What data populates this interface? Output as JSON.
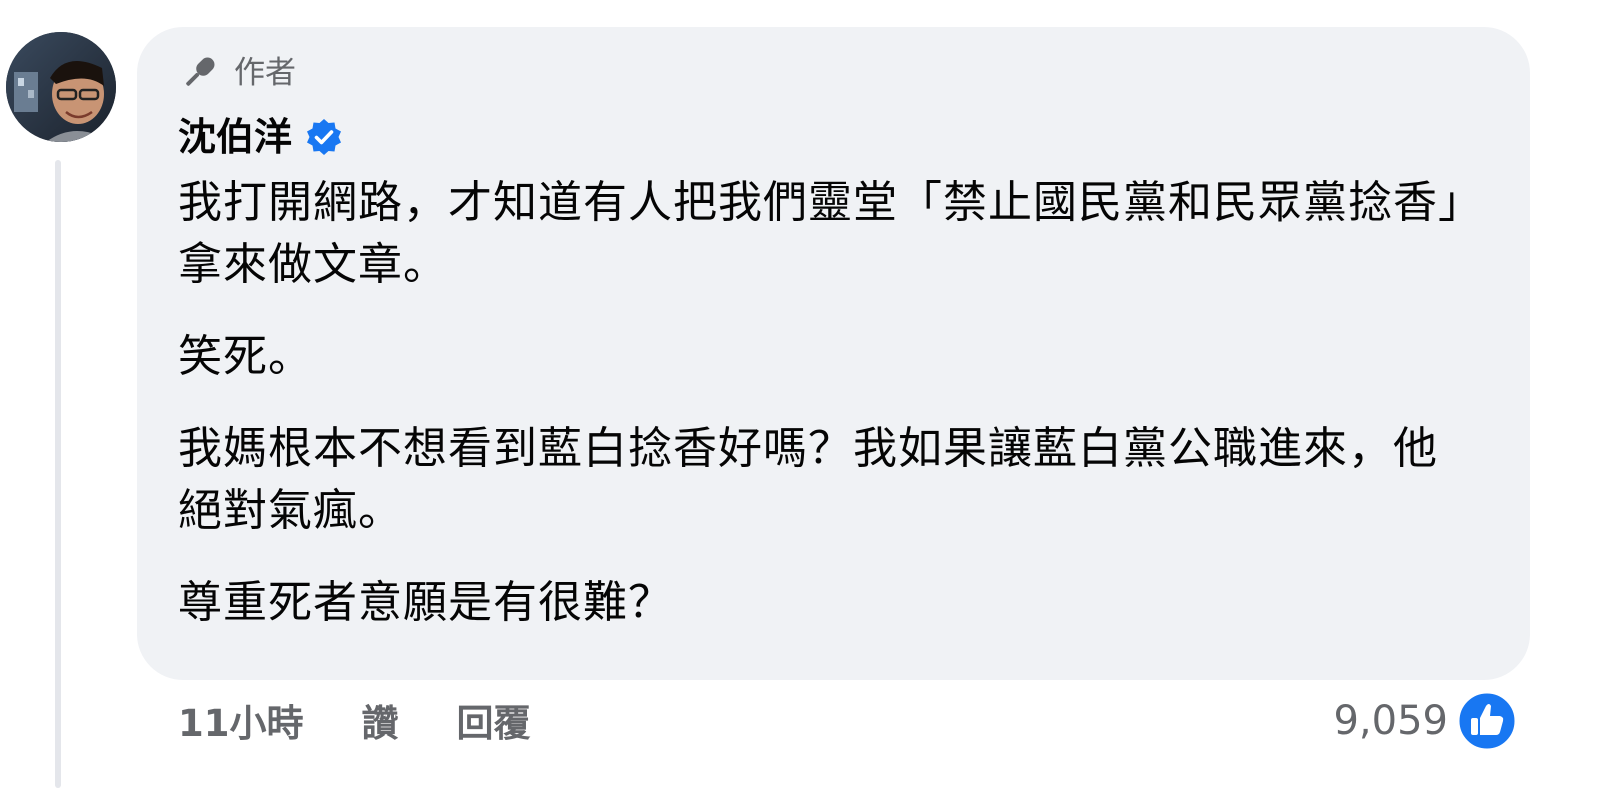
{
  "comment": {
    "author_badge_label": "作者",
    "author_name": "沈伯洋",
    "paragraphs": [
      "我打開網路，才知道有人把我們靈堂「禁止國民黨和民眾黨捻香」拿來做文章。",
      "笑死。",
      "我媽根本不想看到藍白捻香好嗎？我如果讓藍白黨公職進來，他絕對氣瘋。",
      "尊重死者意願是有很難？"
    ],
    "timestamp": "11小時",
    "like_label": "讚",
    "reply_label": "回覆",
    "reaction_count": "9,059"
  },
  "icons": {
    "author_badge": "microphone-icon",
    "verified": "verified-badge-icon",
    "reaction": "thumbs-up-icon"
  },
  "colors": {
    "bubble_bg": "#f0f2f5",
    "secondary_text": "#65676b",
    "primary_text": "#050505",
    "accent_blue": "#1877f2",
    "thread_line": "#e4e6eb"
  }
}
